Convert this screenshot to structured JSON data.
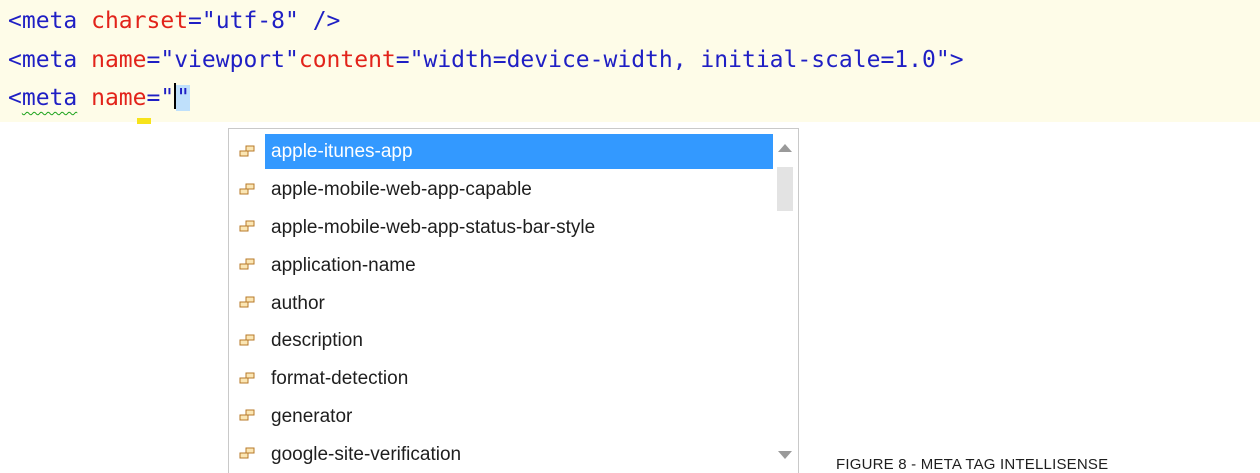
{
  "editor": {
    "lines": [
      {
        "tag": "<meta",
        "attr1": "charset",
        "eq1": "=",
        "val1": "\"utf-8\"",
        "end": " />"
      },
      {
        "tag": "<meta",
        "attr1": "name",
        "eq1": "=",
        "val1": "\"viewport\"",
        "attr2": "content",
        "eq2": "=",
        "val2": "\"width=device-width, initial-scale=1.0\"",
        "end": ">"
      },
      {
        "tag_open": "<",
        "tag_name": "meta",
        "attr1": "name",
        "eq1": "=",
        "quote_open": "\"",
        "quote_close": "\""
      }
    ]
  },
  "completion": {
    "icon": "property-icon",
    "items": [
      "apple-itunes-app",
      "apple-mobile-web-app-capable",
      "apple-mobile-web-app-status-bar-style",
      "application-name",
      "author",
      "description",
      "format-detection",
      "generator",
      "google-site-verification"
    ],
    "selected_index": 0,
    "selection_color": "#3399ff"
  },
  "caption": "FIGURE 8 - META TAG INTELLISENSE"
}
